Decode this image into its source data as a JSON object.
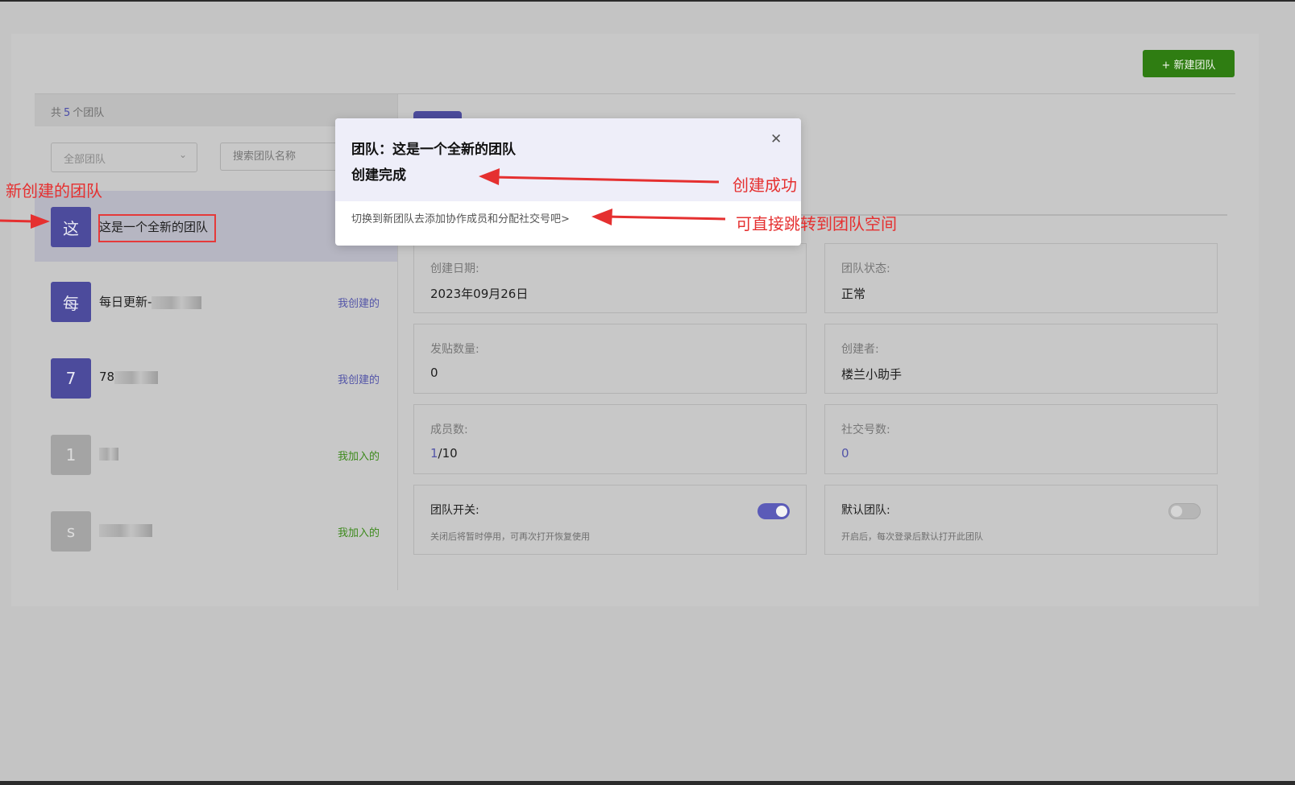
{
  "header": {
    "new_team_button": "+ 新建团队"
  },
  "list": {
    "count_prefix": "共",
    "count": "5",
    "count_suffix": "个团队",
    "filter_select": {
      "value": "全部团队"
    },
    "search": {
      "placeholder": "搜索团队名称"
    },
    "items": [
      {
        "avatar": "这",
        "name": "这是一个全新的团队",
        "tag": ""
      },
      {
        "avatar": "每",
        "name": "每日更新-",
        "tag": "我创建的"
      },
      {
        "avatar": "7",
        "name": "78",
        "tag": "我创建的"
      },
      {
        "avatar": "1",
        "name": "",
        "tag": "我加入的"
      },
      {
        "avatar": "s",
        "name": "",
        "tag": "我加入的"
      }
    ]
  },
  "detail": {
    "created_date_label": "创建日期:",
    "created_date_value": "2023年09月26日",
    "status_label": "团队状态:",
    "status_value": "正常",
    "posts_label": "发贴数量:",
    "posts_value": "0",
    "creator_label": "创建者:",
    "creator_value": "楼兰小助手",
    "members_label": "成员数:",
    "members_current": "1",
    "members_total": "/10",
    "social_label": "社交号数:",
    "social_value": "0",
    "team_switch_label": "团队开关:",
    "team_switch_desc": "关闭后将暂时停用，可再次打开恢复使用",
    "team_switch_on": true,
    "default_team_label": "默认团队:",
    "default_team_desc": "开启后，每次登录后默认打开此团队",
    "default_team_on": false
  },
  "modal": {
    "title_line1": "团队：这是一个全新的团队",
    "title_line2": "创建完成",
    "link_text": "切换到新团队去添加协作成员和分配社交号吧>",
    "close_icon": "close-icon"
  },
  "annotations": {
    "new_team": "新创建的团队",
    "created": "创建成功",
    "jump": "可直接跳转到团队空间"
  },
  "colors": {
    "primary": "#4c4b9c",
    "success_button": "#2f7d12",
    "join_tag": "#3d8a1c",
    "annotation": "#e53030"
  }
}
